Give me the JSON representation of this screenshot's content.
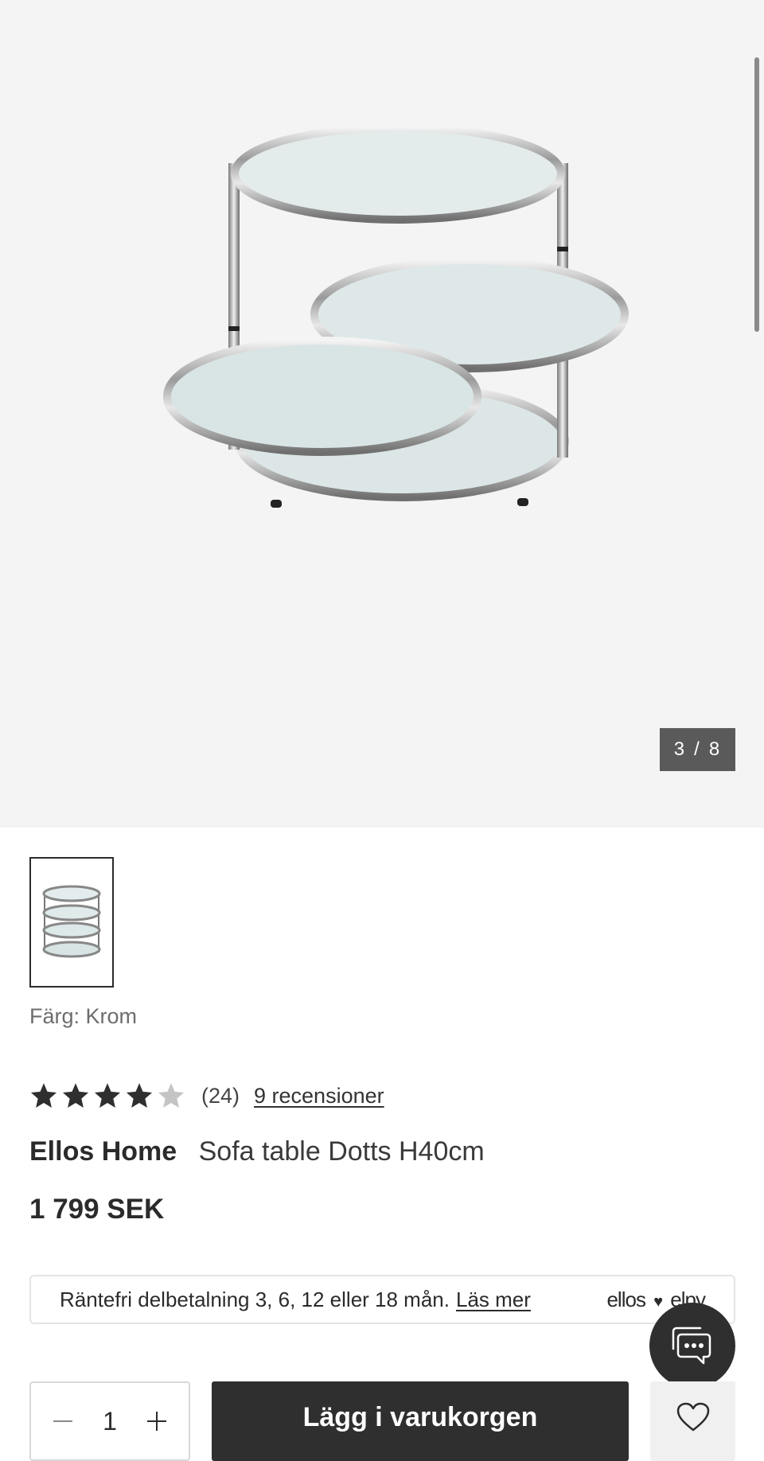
{
  "gallery": {
    "counter_current": "3",
    "counter_separator": "/",
    "counter_total": "8"
  },
  "product": {
    "color_label": "Färg: Krom",
    "rating": 4,
    "rating_max": 5,
    "rating_count": "(24)",
    "reviews_link": "9 recensioner",
    "brand": "Ellos Home",
    "name": "Sofa table Dotts H40cm",
    "price": "1 799 SEK"
  },
  "finance": {
    "text": "Räntefri delbetalning 3, 6, 12 eller 18 mån.",
    "link": "Läs mer",
    "brand_left": "ellos",
    "brand_right": "elpy"
  },
  "purchase": {
    "quantity": "1",
    "add_to_cart": "Lägg i varukorgen"
  },
  "colors": {
    "gallery_bg": "#f4f4f4",
    "dark": "#2f2f2f",
    "star_filled": "#2f2f2f",
    "star_empty": "#c4c4c4"
  },
  "icons": [
    "chat-icon",
    "heart-icon",
    "minus-icon",
    "plus-icon",
    "star-icon"
  ]
}
